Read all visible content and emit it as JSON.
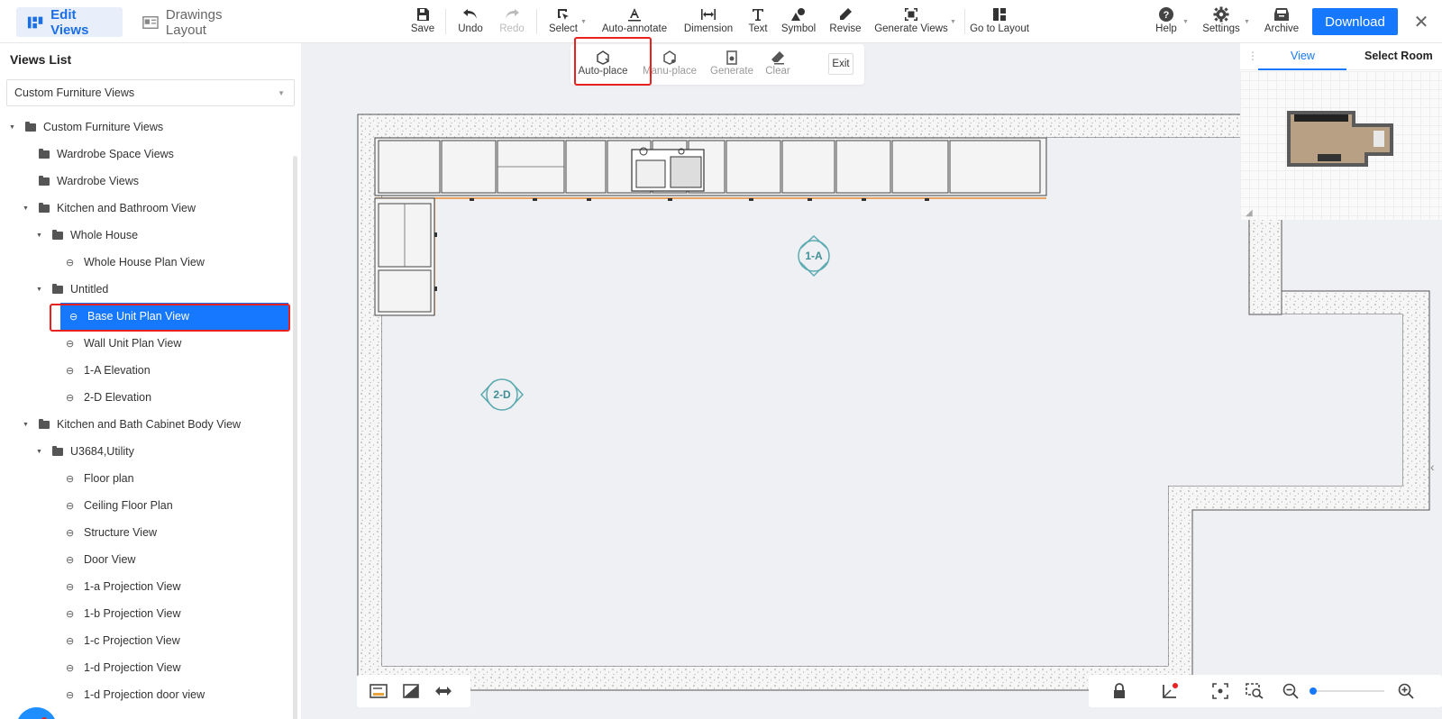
{
  "modes": {
    "edit_views": "Edit Views",
    "drawings_layout": "Drawings Layout"
  },
  "toolbar": {
    "save": "Save",
    "undo": "Undo",
    "redo": "Redo",
    "select": "Select",
    "auto_annotate": "Auto-annotate",
    "dimension": "Dimension",
    "text": "Text",
    "symbol": "Symbol",
    "revise": "Revise",
    "generate_views": "Generate Views",
    "go_to_layout": "Go to Layout",
    "help": "Help",
    "settings": "Settings",
    "archive": "Archive",
    "download": "Download"
  },
  "subtoolbar": {
    "auto_place": "Auto-place",
    "manu_place": "Manu-place",
    "generate": "Generate",
    "clear": "Clear",
    "exit": "Exit"
  },
  "views_list": {
    "title": "Views List",
    "filter": "Custom Furniture Views",
    "items": [
      {
        "label": "Custom Furniture Views",
        "type": "folder",
        "expanded": true
      },
      {
        "label": "Wardrobe Space Views",
        "type": "folder"
      },
      {
        "label": "Wardrobe Views",
        "type": "folder"
      },
      {
        "label": "Kitchen and Bathroom View",
        "type": "folder",
        "expanded": true
      },
      {
        "label": "Whole House",
        "type": "folder",
        "expanded": true
      },
      {
        "label": "Whole House Plan View",
        "type": "view"
      },
      {
        "label": "Untitled",
        "type": "folder",
        "expanded": true
      },
      {
        "label": "Base Unit Plan View",
        "type": "view",
        "selected": true
      },
      {
        "label": "Wall Unit Plan View",
        "type": "view"
      },
      {
        "label": "1-A Elevation",
        "type": "view"
      },
      {
        "label": "2-D Elevation",
        "type": "view"
      },
      {
        "label": "Kitchen and Bath Cabinet Body View",
        "type": "folder",
        "expanded": true
      },
      {
        "label": "U3684,Utility",
        "type": "folder",
        "expanded": true
      },
      {
        "label": "Floor plan",
        "type": "view"
      },
      {
        "label": "Ceiling Floor Plan",
        "type": "view"
      },
      {
        "label": "Structure View",
        "type": "view"
      },
      {
        "label": "Door View",
        "type": "view"
      },
      {
        "label": "1-a Projection View",
        "type": "view"
      },
      {
        "label": "1-b Projection View",
        "type": "view"
      },
      {
        "label": "1-c Projection View",
        "type": "view"
      },
      {
        "label": "1-d Projection View",
        "type": "view"
      },
      {
        "label": "1-d Projection door view",
        "type": "view"
      }
    ]
  },
  "canvas": {
    "marker_1": "1-A",
    "marker_2": "2-D"
  },
  "minimap": {
    "tab_view": "View",
    "tab_select_room": "Select Room"
  },
  "colors": {
    "accent": "#1677ff",
    "highlight": "#e8201f",
    "marker": "#5aaab0"
  }
}
